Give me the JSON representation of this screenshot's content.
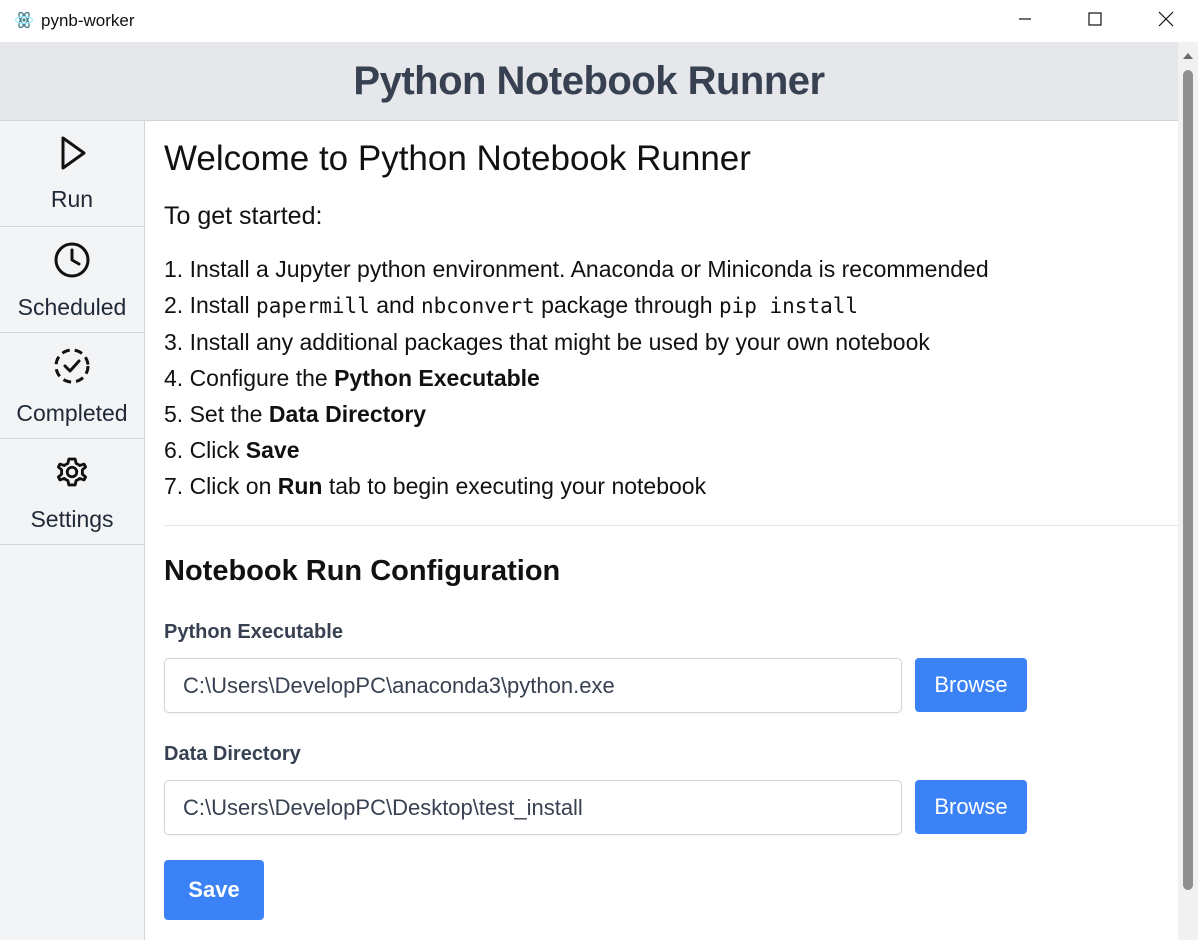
{
  "window": {
    "title": "pynb-worker",
    "icon": "electron-app-icon",
    "controls": [
      "minimize-icon",
      "maximize-icon",
      "close-icon"
    ]
  },
  "header": {
    "title": "Python Notebook Runner"
  },
  "sidebar": {
    "items": [
      {
        "label": "Run",
        "icon": "play-icon"
      },
      {
        "label": "Scheduled",
        "icon": "clock-icon"
      },
      {
        "label": "Completed",
        "icon": "dashed-check-circle-icon"
      },
      {
        "label": "Settings",
        "icon": "gear-icon"
      }
    ]
  },
  "main": {
    "welcome": "Welcome to Python Notebook Runner",
    "getting_started": "To get started:",
    "steps": [
      {
        "a": "1. Install a Jupyter python environment. Anaconda or Miniconda is recommended"
      },
      {
        "a": "2. Install ",
        "code1": "papermill",
        "b": " and ",
        "code2": "nbconvert",
        "c": " package through ",
        "code3": "pip install"
      },
      {
        "a": "3. Install any additional packages that might be used by your own notebook"
      },
      {
        "a": "4. Configure the ",
        "bold": "Python Executable"
      },
      {
        "a": "5. Set the ",
        "bold": "Data Directory"
      },
      {
        "a": "6. Click ",
        "bold": "Save"
      },
      {
        "a": "7. Click on ",
        "bold": "Run",
        "b": " tab to begin executing your notebook"
      }
    ],
    "config": {
      "title": "Notebook Run Configuration",
      "python_label": "Python Executable",
      "python_value": "C:\\Users\\DevelopPC\\anaconda3\\python.exe",
      "data_label": "Data Directory",
      "data_value": "C:\\Users\\DevelopPC\\Desktop\\test_install",
      "browse_label": "Browse",
      "save_label": "Save"
    }
  },
  "colors": {
    "accent": "#3b82f6",
    "header_bg": "#e5e7eb",
    "sidebar_bg": "#f3f4f6"
  }
}
